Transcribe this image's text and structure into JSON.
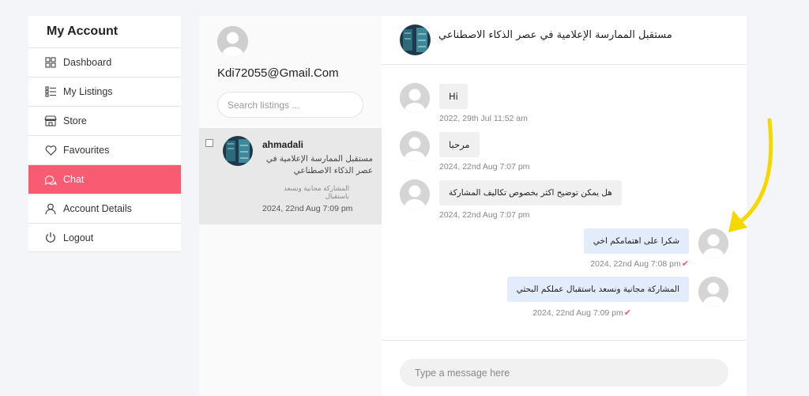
{
  "account": {
    "title": "My Account",
    "items": [
      {
        "label": "Dashboard",
        "icon": "dashboard-icon"
      },
      {
        "label": "My Listings",
        "icon": "listings-icon"
      },
      {
        "label": "Store",
        "icon": "store-icon"
      },
      {
        "label": "Favourites",
        "icon": "heart-icon"
      },
      {
        "label": "Chat",
        "icon": "chat-icon",
        "active": true
      },
      {
        "label": "Account Details",
        "icon": "user-icon"
      },
      {
        "label": "Logout",
        "icon": "power-icon"
      }
    ]
  },
  "conversations": {
    "user_email": "Kdi72055@Gmail.Com",
    "search_placeholder": "Search listings ...",
    "items": [
      {
        "name": "ahmadali",
        "listing_title": "مستقبل الممارسة الإعلامية في عصر الذكاء الاصطناعي",
        "preview": "المشاركة مجانية ونسعد باستقبال",
        "time": "2024, 22nd Aug 7:09 pm"
      }
    ]
  },
  "chat": {
    "title": "مستقبل الممارسة الإعلامية في عصر الذكاء الاصطناعي",
    "messages": [
      {
        "direction": "in",
        "text": "Hi",
        "time": "2022, 29th Jul 11:52 am"
      },
      {
        "direction": "in",
        "text": "مرحبا",
        "time": "2024, 22nd Aug 7:07 pm"
      },
      {
        "direction": "in",
        "text": "هل يمكن توضيح اكثر بخصوص تكاليف المشاركة",
        "time": "2024, 22nd Aug 7:07 pm"
      },
      {
        "direction": "out",
        "text": "شكرا على اهتمامكم اخي",
        "time": "2024, 22nd Aug 7:08 pm",
        "read": true
      },
      {
        "direction": "out",
        "text": "المشاركة مجانية ونسعد باستقبال عملكم البحثي",
        "time": "2024, 22nd Aug 7:09 pm",
        "read": true
      }
    ],
    "composer_placeholder": "Type a message here"
  },
  "colors": {
    "accent": "#f95b72",
    "annotation_arrow": "#f5d800",
    "outgoing_bubble": "#e3ecfb",
    "incoming_bubble": "#f0f0f0"
  }
}
